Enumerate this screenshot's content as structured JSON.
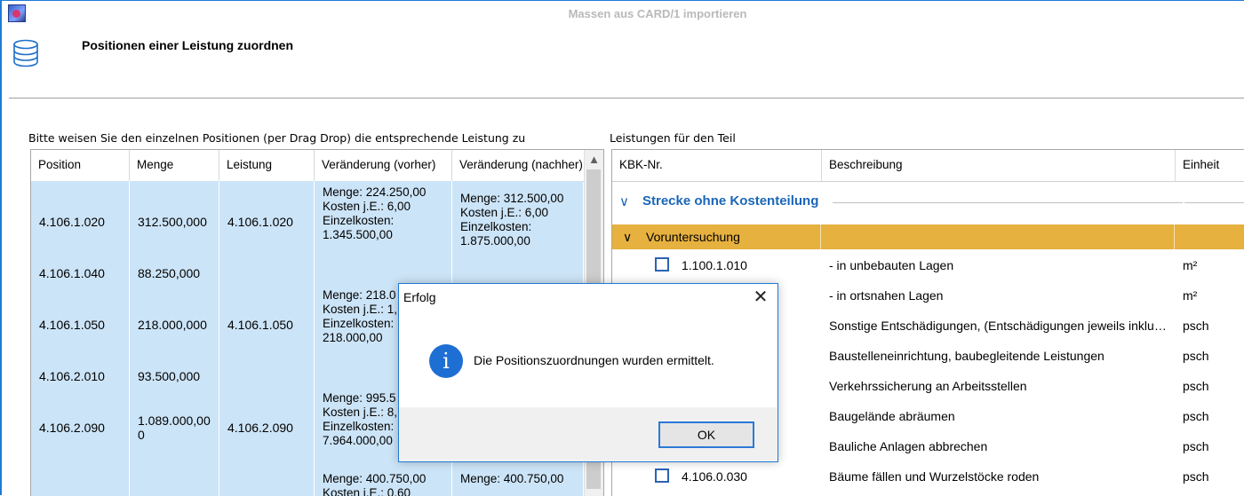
{
  "window": {
    "title": "Massen aus CARD/1 importieren"
  },
  "header": {
    "title": "Positionen einer Leistung zuordnen",
    "icon": "database-icon"
  },
  "left": {
    "caption": "Bitte weisen Sie den einzelnen Positionen (per Drag  Drop) die entsprechende Leistung zu",
    "columns": [
      "Position",
      "Menge",
      "Leistung",
      "Veränderung (vorher)",
      "Veränderung (nachher)"
    ],
    "rows": [
      {
        "position": "4.106.1.020",
        "menge": "312.500,000",
        "leistung": "4.106.1.020",
        "vorher": [
          "Menge: 224.250,00",
          "Kosten j.E.: 6,00",
          "Einzelkosten:",
          "1.345.500,00"
        ],
        "nachher": [
          "Menge: 312.500,00",
          "Kosten j.E.: 6,00",
          "Einzelkosten:",
          "1.875.000,00"
        ]
      },
      {
        "position": "4.106.1.040",
        "menge": "88.250,000",
        "leistung": "",
        "vorher": [],
        "nachher": []
      },
      {
        "position": "4.106.1.050",
        "menge": "218.000,000",
        "leistung": "4.106.1.050",
        "vorher": [
          "Menge: 218.0",
          "Kosten j.E.: 1,",
          "Einzelkosten:",
          "218.000,00"
        ],
        "nachher": []
      },
      {
        "position": "4.106.2.010",
        "menge": "93.500,000",
        "leistung": "",
        "vorher": [],
        "nachher": []
      },
      {
        "position": "4.106.2.090",
        "menge": "1.089.000,00\n0",
        "leistung": "4.106.2.090",
        "vorher": [
          "Menge: 995.5",
          "Kosten j.E.: 8,",
          "Einzelkosten:",
          "7.964.000,00"
        ],
        "nachher": []
      },
      {
        "position": "",
        "menge": "",
        "leistung": "",
        "vorher": [
          "Menge: 400.750,00",
          "Kosten j.E.: 0,60"
        ],
        "nachher": [
          "Menge: 400.750,00"
        ]
      }
    ]
  },
  "right": {
    "caption": "Leistungen für den Teil",
    "columns": [
      "KBK-Nr.",
      "Beschreibung",
      "Einheit"
    ],
    "group": "Strecke ohne Kostenteilung",
    "subgroup": "Voruntersuchung",
    "items": [
      {
        "kbk": "1.100.1.010",
        "desc": "- in unbebauten Lagen",
        "unit": "m²"
      },
      {
        "kbk": "",
        "desc": "- in ortsnahen Lagen",
        "unit": "m²"
      },
      {
        "kbk": "",
        "desc": "Sonstige Entschädigungen, (Entschädigungen jeweils inklusiv...",
        "unit": "psch"
      },
      {
        "kbk": "",
        "desc": "Baustelleneinrichtung, baubegleitende Leistungen",
        "unit": "psch"
      },
      {
        "kbk": "",
        "desc": "Verkehrssicherung an Arbeitsstellen",
        "unit": "psch"
      },
      {
        "kbk": "",
        "desc": "Baugelände abräumen",
        "unit": "psch"
      },
      {
        "kbk": "",
        "desc": "Bauliche Anlagen abbrechen",
        "unit": "psch"
      },
      {
        "kbk": "4.106.0.030",
        "desc": "Bäume fällen und Wurzelstöcke roden",
        "unit": "psch"
      }
    ]
  },
  "dialog": {
    "title": "Erfolg",
    "message": "Die Positionszuordnungen wurden ermittelt.",
    "ok_label": "OK",
    "icon": "info-icon"
  },
  "colors": {
    "accent": "#1f7ad6",
    "selection": "#cce4f7",
    "group_header": "#e6b13f",
    "group_text": "#1a66b8"
  }
}
